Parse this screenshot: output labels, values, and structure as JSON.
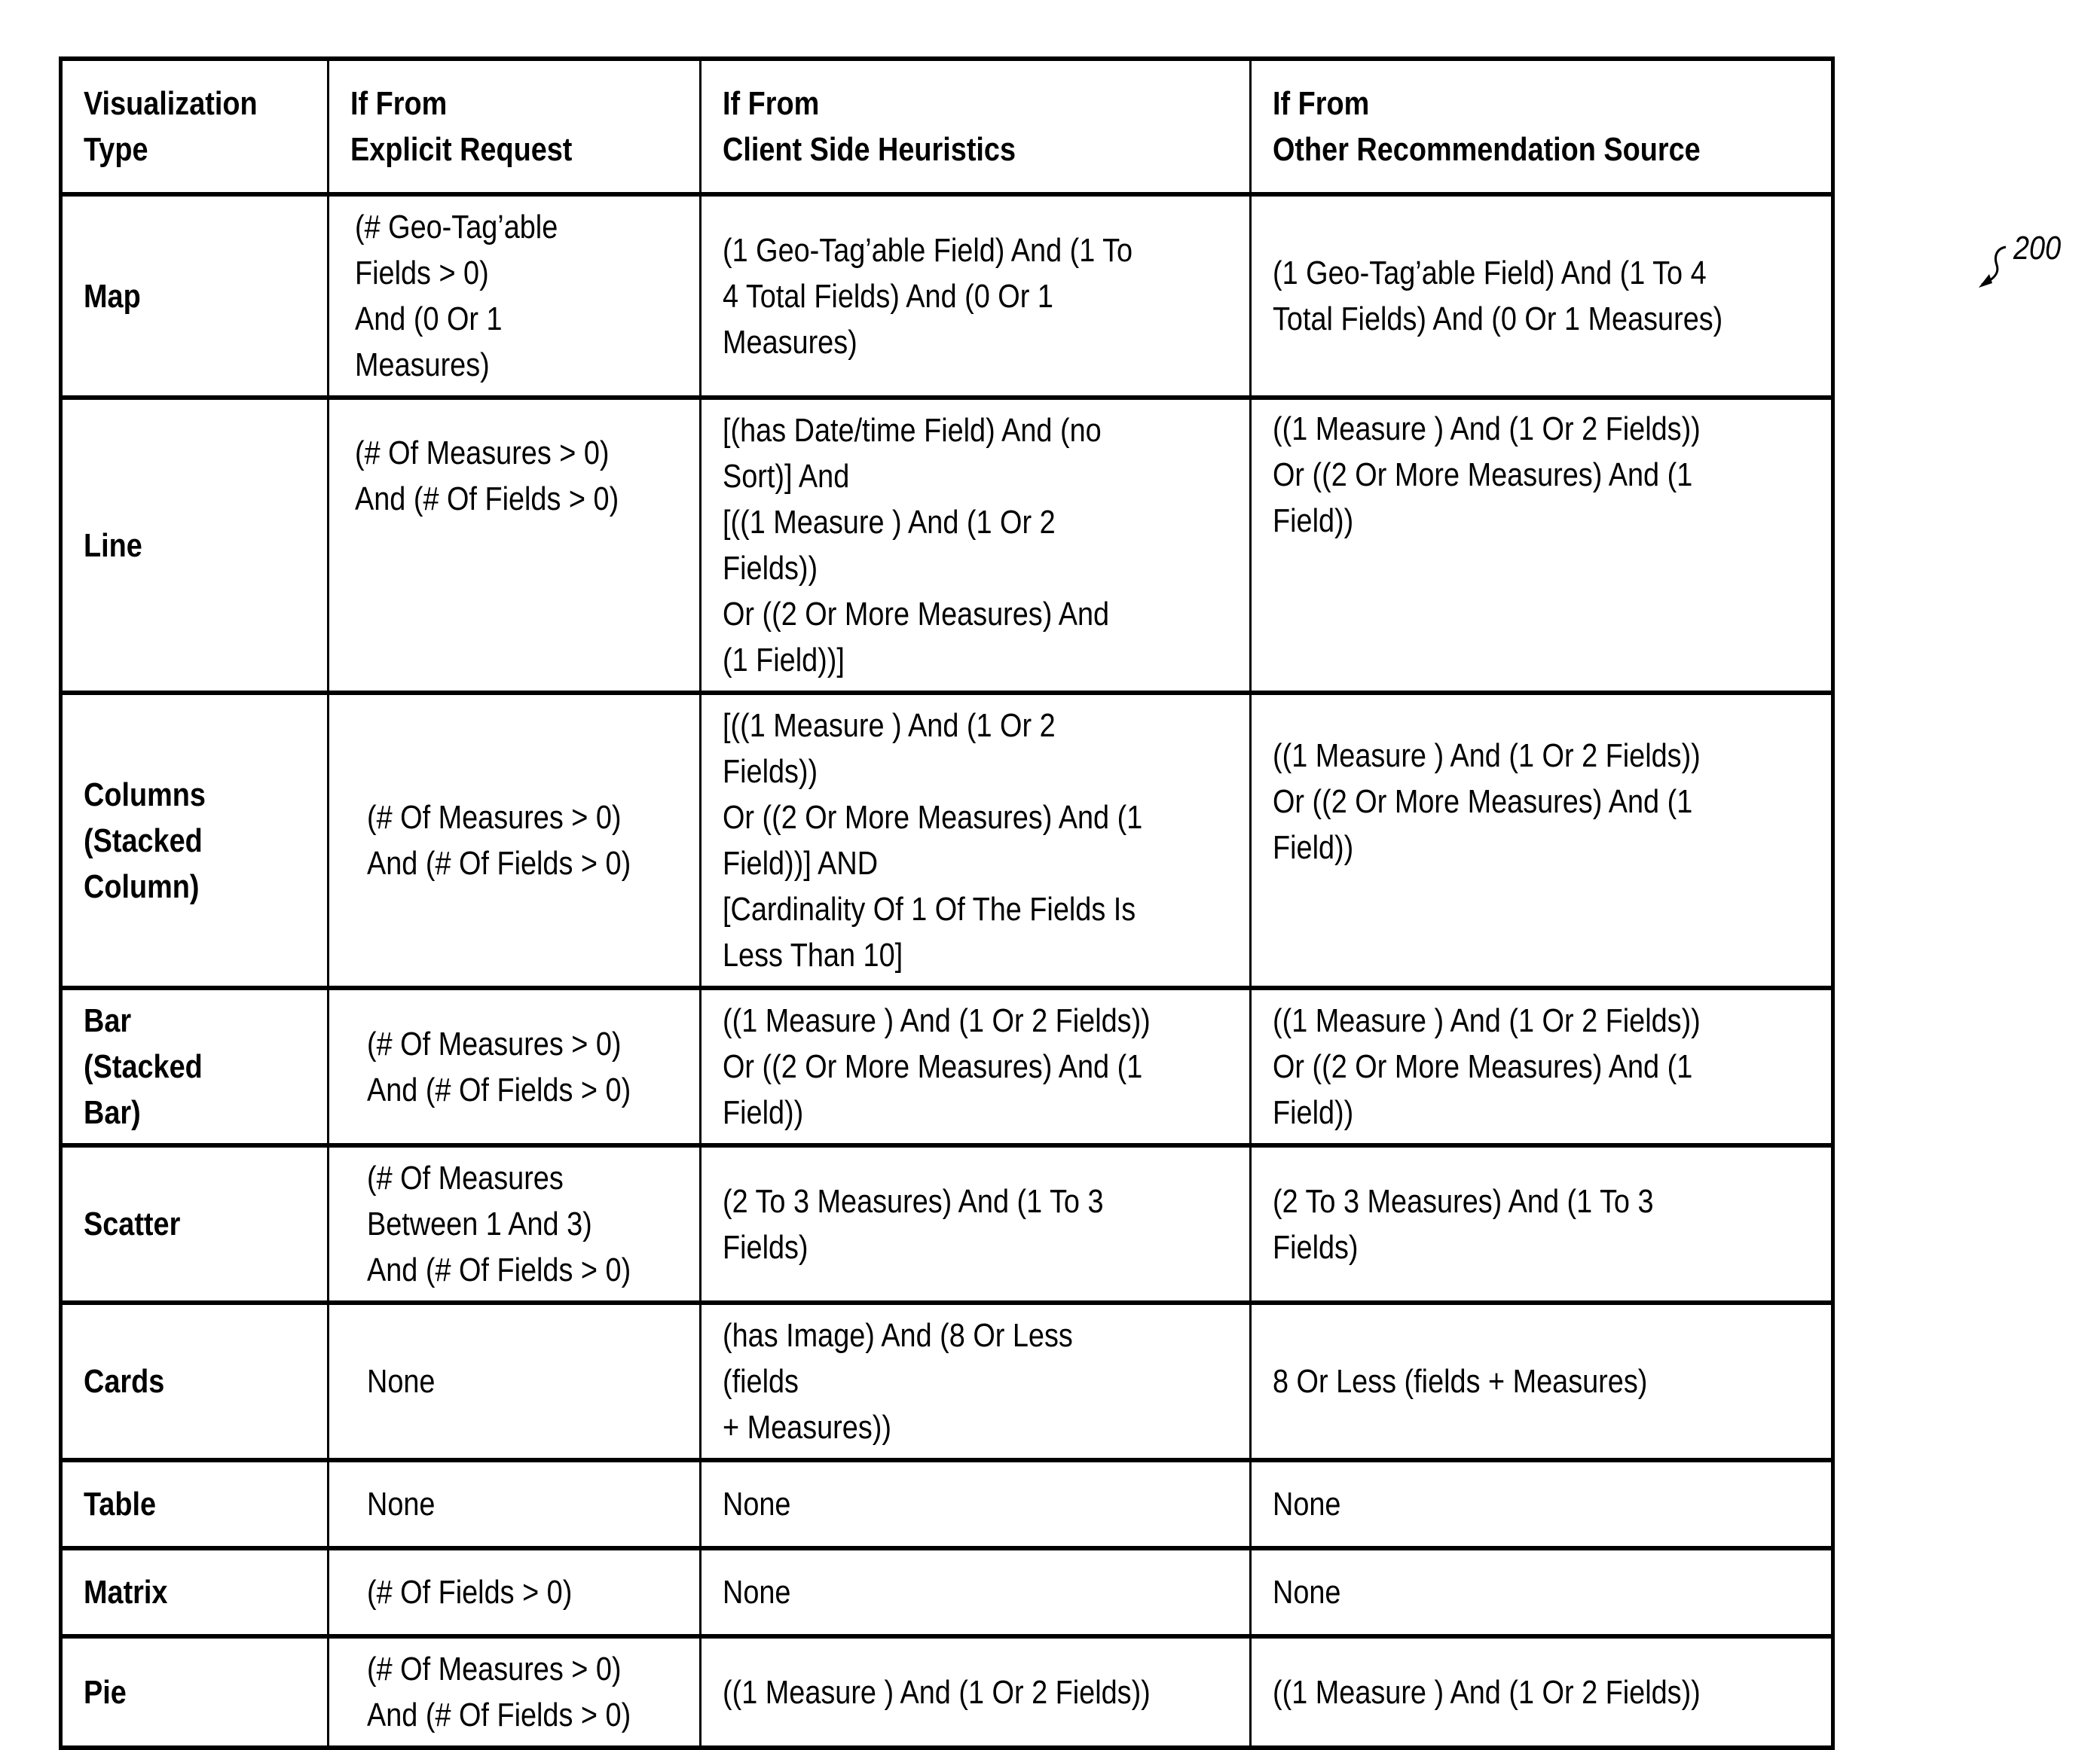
{
  "figure": {
    "reference_numeral": "200"
  },
  "table": {
    "headers": [
      "Visualization\nType",
      "If From\nExplicit Request",
      "If From\nClient Side Heuristics",
      "If From\nOther Recommendation Source"
    ],
    "rows": [
      {
        "type": "Map",
        "explicit": "(# Geo-Tag’able\nFields > 0)\nAnd  (0 Or 1 Measures)",
        "client": "(1 Geo-Tag’able Field) And (1 To\n4 Total Fields) And  (0 Or 1\nMeasures)",
        "other": "(1 Geo-Tag’able Field) And (1 To 4\nTotal Fields) And  (0 Or 1 Measures)"
      },
      {
        "type": "Line",
        "explicit": "(# Of Measures > 0)\nAnd (# Of Fields > 0)",
        "client": "[(has Date/time Field) And (no\nSort)] And\n[((1 Measure ) And (1 Or 2 Fields))\nOr ((2 Or More Measures) And\n(1 Field))]",
        "other": "((1 Measure ) And (1 Or 2 Fields))\nOr ((2 Or More Measures) And (1\nField))"
      },
      {
        "type": "Columns\n(Stacked\nColumn)",
        "explicit": "(# Of Measures > 0)\nAnd (# Of Fields > 0)",
        "client": "[((1 Measure ) And (1 Or 2 Fields))\nOr ((2 Or More Measures) And (1\nField))] AND\n[Cardinality Of 1 Of The Fields Is\nLess Than 10]",
        "other": "((1 Measure ) And (1 Or 2 Fields))\nOr ((2 Or More Measures) And (1\nField))"
      },
      {
        "type": "Bar\n(Stacked\nBar)",
        "explicit": "(# Of Measures > 0)\nAnd (# Of Fields > 0)",
        "client": "((1 Measure ) And (1 Or 2 Fields))\nOr ((2 Or More Measures) And (1\nField))",
        "other": "((1 Measure ) And (1 Or 2 Fields))\nOr ((2 Or More Measures) And (1\nField))"
      },
      {
        "type": "Scatter",
        "explicit": "(# Of Measures\nBetween 1 And 3)\nAnd (# Of Fields > 0)",
        "client": "(2 To 3 Measures) And (1 To 3\nFields)",
        "other": "(2 To 3 Measures) And (1 To 3\nFields)"
      },
      {
        "type": "Cards",
        "explicit": "None",
        "client": "(has Image) And (8 Or Less (fields\n+ Measures))",
        "other": "8 Or Less (fields + Measures)"
      },
      {
        "type": "Table",
        "explicit": "None",
        "client": "None",
        "other": "None"
      },
      {
        "type": "Matrix",
        "explicit": "(# Of Fields > 0)",
        "client": "None",
        "other": "None"
      },
      {
        "type": "Pie",
        "explicit": "(# Of Measures > 0)\nAnd (# Of Fields > 0)",
        "client": "((1 Measure ) And (1 Or 2 Fields))",
        "other": "((1 Measure ) And (1 Or 2 Fields))"
      }
    ]
  }
}
